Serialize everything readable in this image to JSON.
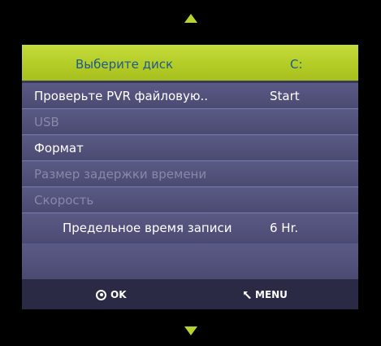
{
  "header": {
    "title": "Выберите диск",
    "value": "C:"
  },
  "menu": {
    "items": [
      {
        "label": "Проверьте PVR файловую..",
        "value": "Start",
        "enabled": true
      },
      {
        "label": "USB",
        "value": "",
        "enabled": false
      },
      {
        "label": "Формат",
        "value": "",
        "enabled": true
      },
      {
        "label": "Размер задержки времени",
        "value": "",
        "enabled": false
      },
      {
        "label": "Скорость",
        "value": "",
        "enabled": false
      },
      {
        "label": "Предельное время записи",
        "value": "6 Hr.",
        "enabled": true
      }
    ]
  },
  "footer": {
    "ok_label": "OK",
    "menu_label": "MENU"
  },
  "colors": {
    "accent": "#b4cc26",
    "panel": "#4a4a73",
    "footer": "#2a2a45",
    "header_text": "#1e5a8e"
  },
  "icons": {
    "scroll_up": "triangle-up-icon",
    "scroll_down": "triangle-down-icon",
    "ok": "ok-circle-icon",
    "back": "back-arrow-icon"
  }
}
